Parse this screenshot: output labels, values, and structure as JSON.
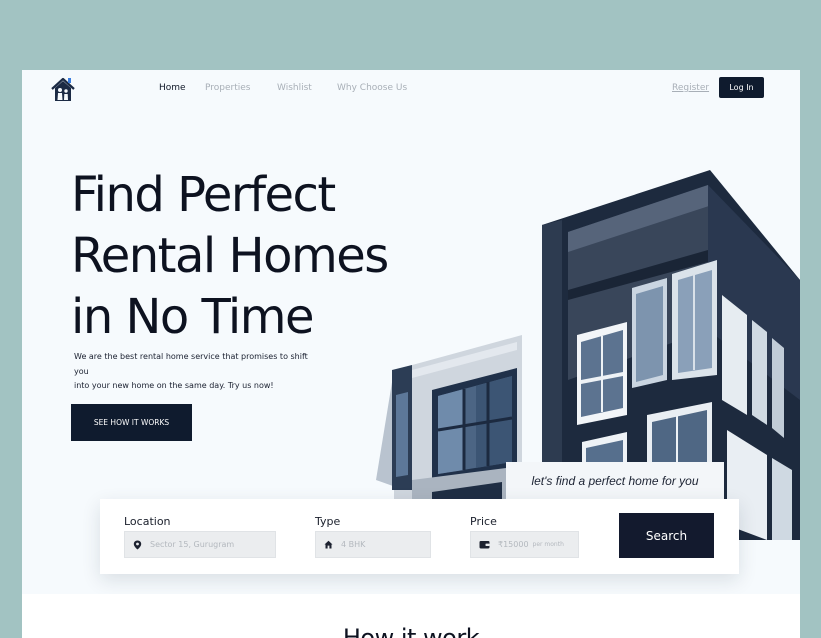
{
  "nav": {
    "items": [
      {
        "label": "Home",
        "active": true
      },
      {
        "label": "Properties",
        "active": false
      },
      {
        "label": "Wishlist",
        "active": false
      },
      {
        "label": "Why Choose Us",
        "active": false
      }
    ],
    "register": "Register",
    "login": "Log In"
  },
  "logo": {
    "icon": "house-family-icon"
  },
  "hero": {
    "title_lines": [
      "Find Perfect",
      "Rental Homes",
      "in No Time"
    ],
    "subtitle_lines": [
      "We are the best rental home service that promises to shift you",
      "into your new home on the same day.  Try us now!"
    ],
    "cta": "SEE HOW IT WORKS",
    "tagline": "let's find a perfect home for you"
  },
  "search": {
    "location": {
      "label": "Location",
      "placeholder": "Sector 15, Gurugram",
      "icon": "map-pin-icon"
    },
    "type": {
      "label": "Type",
      "placeholder": "4 BHK",
      "icon": "home-icon"
    },
    "price": {
      "label": "Price",
      "placeholder": "₹15000",
      "suffix": "per month",
      "icon": "wallet-icon"
    },
    "button": "Search"
  },
  "section": {
    "heading": "How it work"
  },
  "colors": {
    "accent": "#0f1b2e",
    "background": "#a2c3c2",
    "page": "#f6fafd"
  }
}
